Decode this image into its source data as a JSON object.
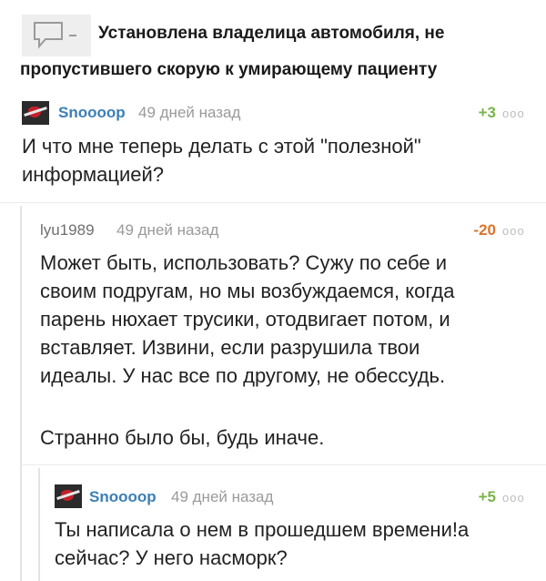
{
  "post": {
    "title_line1": "Установлена владелица автомобиля, не",
    "title_line2": "пропустившего скорую к умирающему пациенту",
    "icon": "comment-bubble-icon"
  },
  "comments": [
    {
      "user": "Snoooop",
      "time": "49 дней назад",
      "rating": "+3",
      "more": "ооо",
      "lines": [
        "И что мне теперь делать с этой \"полезной\"",
        "информацией?"
      ]
    },
    {
      "user": "lyu1989",
      "time": "49 дней назад",
      "rating": "-20",
      "more": "ооо",
      "lines": [
        "Может быть, использовать? Сужу по себе и",
        "своим подругам, но мы возбуждаемся, когда",
        "парень нюхает трусики, отодвигает потом, и",
        "вставляет. Извини, если разрушила твои",
        "идеалы. У нас все по другому, не обессудь.",
        "",
        "Странно было бы, будь иначе."
      ]
    },
    {
      "user": "Snoooop",
      "time": "49 дней назад",
      "rating": "+5",
      "more": "ооо",
      "lines": [
        "Ты написала о нем в прошедшем времени!а",
        "сейчас? У него насморк?"
      ]
    }
  ],
  "colors": {
    "username": "#3c7fb5",
    "positive": "#7bb34a",
    "negative": "#d9742c",
    "meta": "#9a9a9a"
  }
}
